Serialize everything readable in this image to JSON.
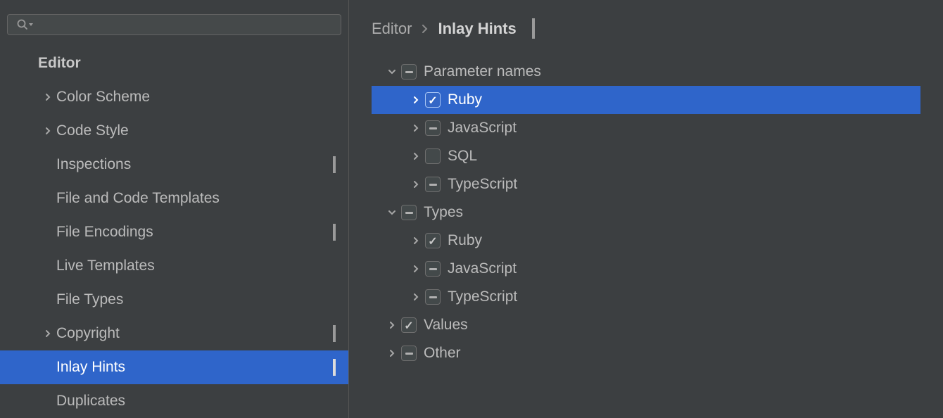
{
  "sidebar": {
    "header": "Editor",
    "items": [
      {
        "label": "Color Scheme",
        "hasChevron": true,
        "hasBadge": false,
        "selected": false
      },
      {
        "label": "Code Style",
        "hasChevron": true,
        "hasBadge": false,
        "selected": false
      },
      {
        "label": "Inspections",
        "hasChevron": false,
        "hasBadge": true,
        "selected": false
      },
      {
        "label": "File and Code Templates",
        "hasChevron": false,
        "hasBadge": false,
        "selected": false
      },
      {
        "label": "File Encodings",
        "hasChevron": false,
        "hasBadge": true,
        "selected": false
      },
      {
        "label": "Live Templates",
        "hasChevron": false,
        "hasBadge": false,
        "selected": false
      },
      {
        "label": "File Types",
        "hasChevron": false,
        "hasBadge": false,
        "selected": false
      },
      {
        "label": "Copyright",
        "hasChevron": true,
        "hasBadge": true,
        "selected": false
      },
      {
        "label": "Inlay Hints",
        "hasChevron": false,
        "hasBadge": true,
        "selected": true
      },
      {
        "label": "Duplicates",
        "hasChevron": false,
        "hasBadge": false,
        "selected": false
      }
    ]
  },
  "breadcrumb": {
    "parent": "Editor",
    "current": "Inlay Hints"
  },
  "tree": [
    {
      "label": "Parameter names",
      "level": 0,
      "expanded": true,
      "state": "mixed",
      "selected": false
    },
    {
      "label": "Ruby",
      "level": 1,
      "expanded": false,
      "state": "checked",
      "selected": true
    },
    {
      "label": "JavaScript",
      "level": 1,
      "expanded": false,
      "state": "mixed",
      "selected": false
    },
    {
      "label": "SQL",
      "level": 1,
      "expanded": false,
      "state": "unchecked",
      "selected": false
    },
    {
      "label": "TypeScript",
      "level": 1,
      "expanded": false,
      "state": "mixed",
      "selected": false
    },
    {
      "label": "Types",
      "level": 0,
      "expanded": true,
      "state": "mixed",
      "selected": false
    },
    {
      "label": "Ruby",
      "level": 1,
      "expanded": false,
      "state": "checked",
      "selected": false
    },
    {
      "label": "JavaScript",
      "level": 1,
      "expanded": false,
      "state": "mixed",
      "selected": false
    },
    {
      "label": "TypeScript",
      "level": 1,
      "expanded": false,
      "state": "mixed",
      "selected": false
    },
    {
      "label": "Values",
      "level": 0,
      "expanded": false,
      "state": "checked",
      "selected": false
    },
    {
      "label": "Other",
      "level": 0,
      "expanded": false,
      "state": "mixed",
      "selected": false
    }
  ]
}
